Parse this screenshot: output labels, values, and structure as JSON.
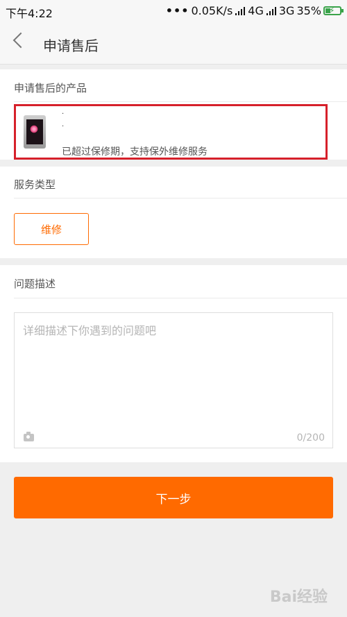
{
  "status_bar": {
    "time": "下午4:22",
    "dots": "•••",
    "speed": "0.05K/s",
    "network1": "4G",
    "network2": "3G",
    "battery": "35%"
  },
  "nav": {
    "title": "申请售后",
    "back_icon": "chevron-left-icon"
  },
  "product_section": {
    "label": "申请售后的产品",
    "item": {
      "name_line1": "·",
      "name_line2": "·",
      "warranty_note": "已超过保修期，支持保外维修服务",
      "image_icon": "phone-thumbnail"
    },
    "highlight_color": "#d6202a"
  },
  "service_section": {
    "label": "服务类型",
    "options": [
      "维修"
    ],
    "selected": "维修"
  },
  "problem_section": {
    "label": "问题描述",
    "placeholder": "详细描述下你遇到的问题吧",
    "counter": "0/200",
    "camera_icon": "camera-icon"
  },
  "next_button": {
    "label": "下一步",
    "color": "#ff6a00"
  },
  "watermark": "Bai经验"
}
